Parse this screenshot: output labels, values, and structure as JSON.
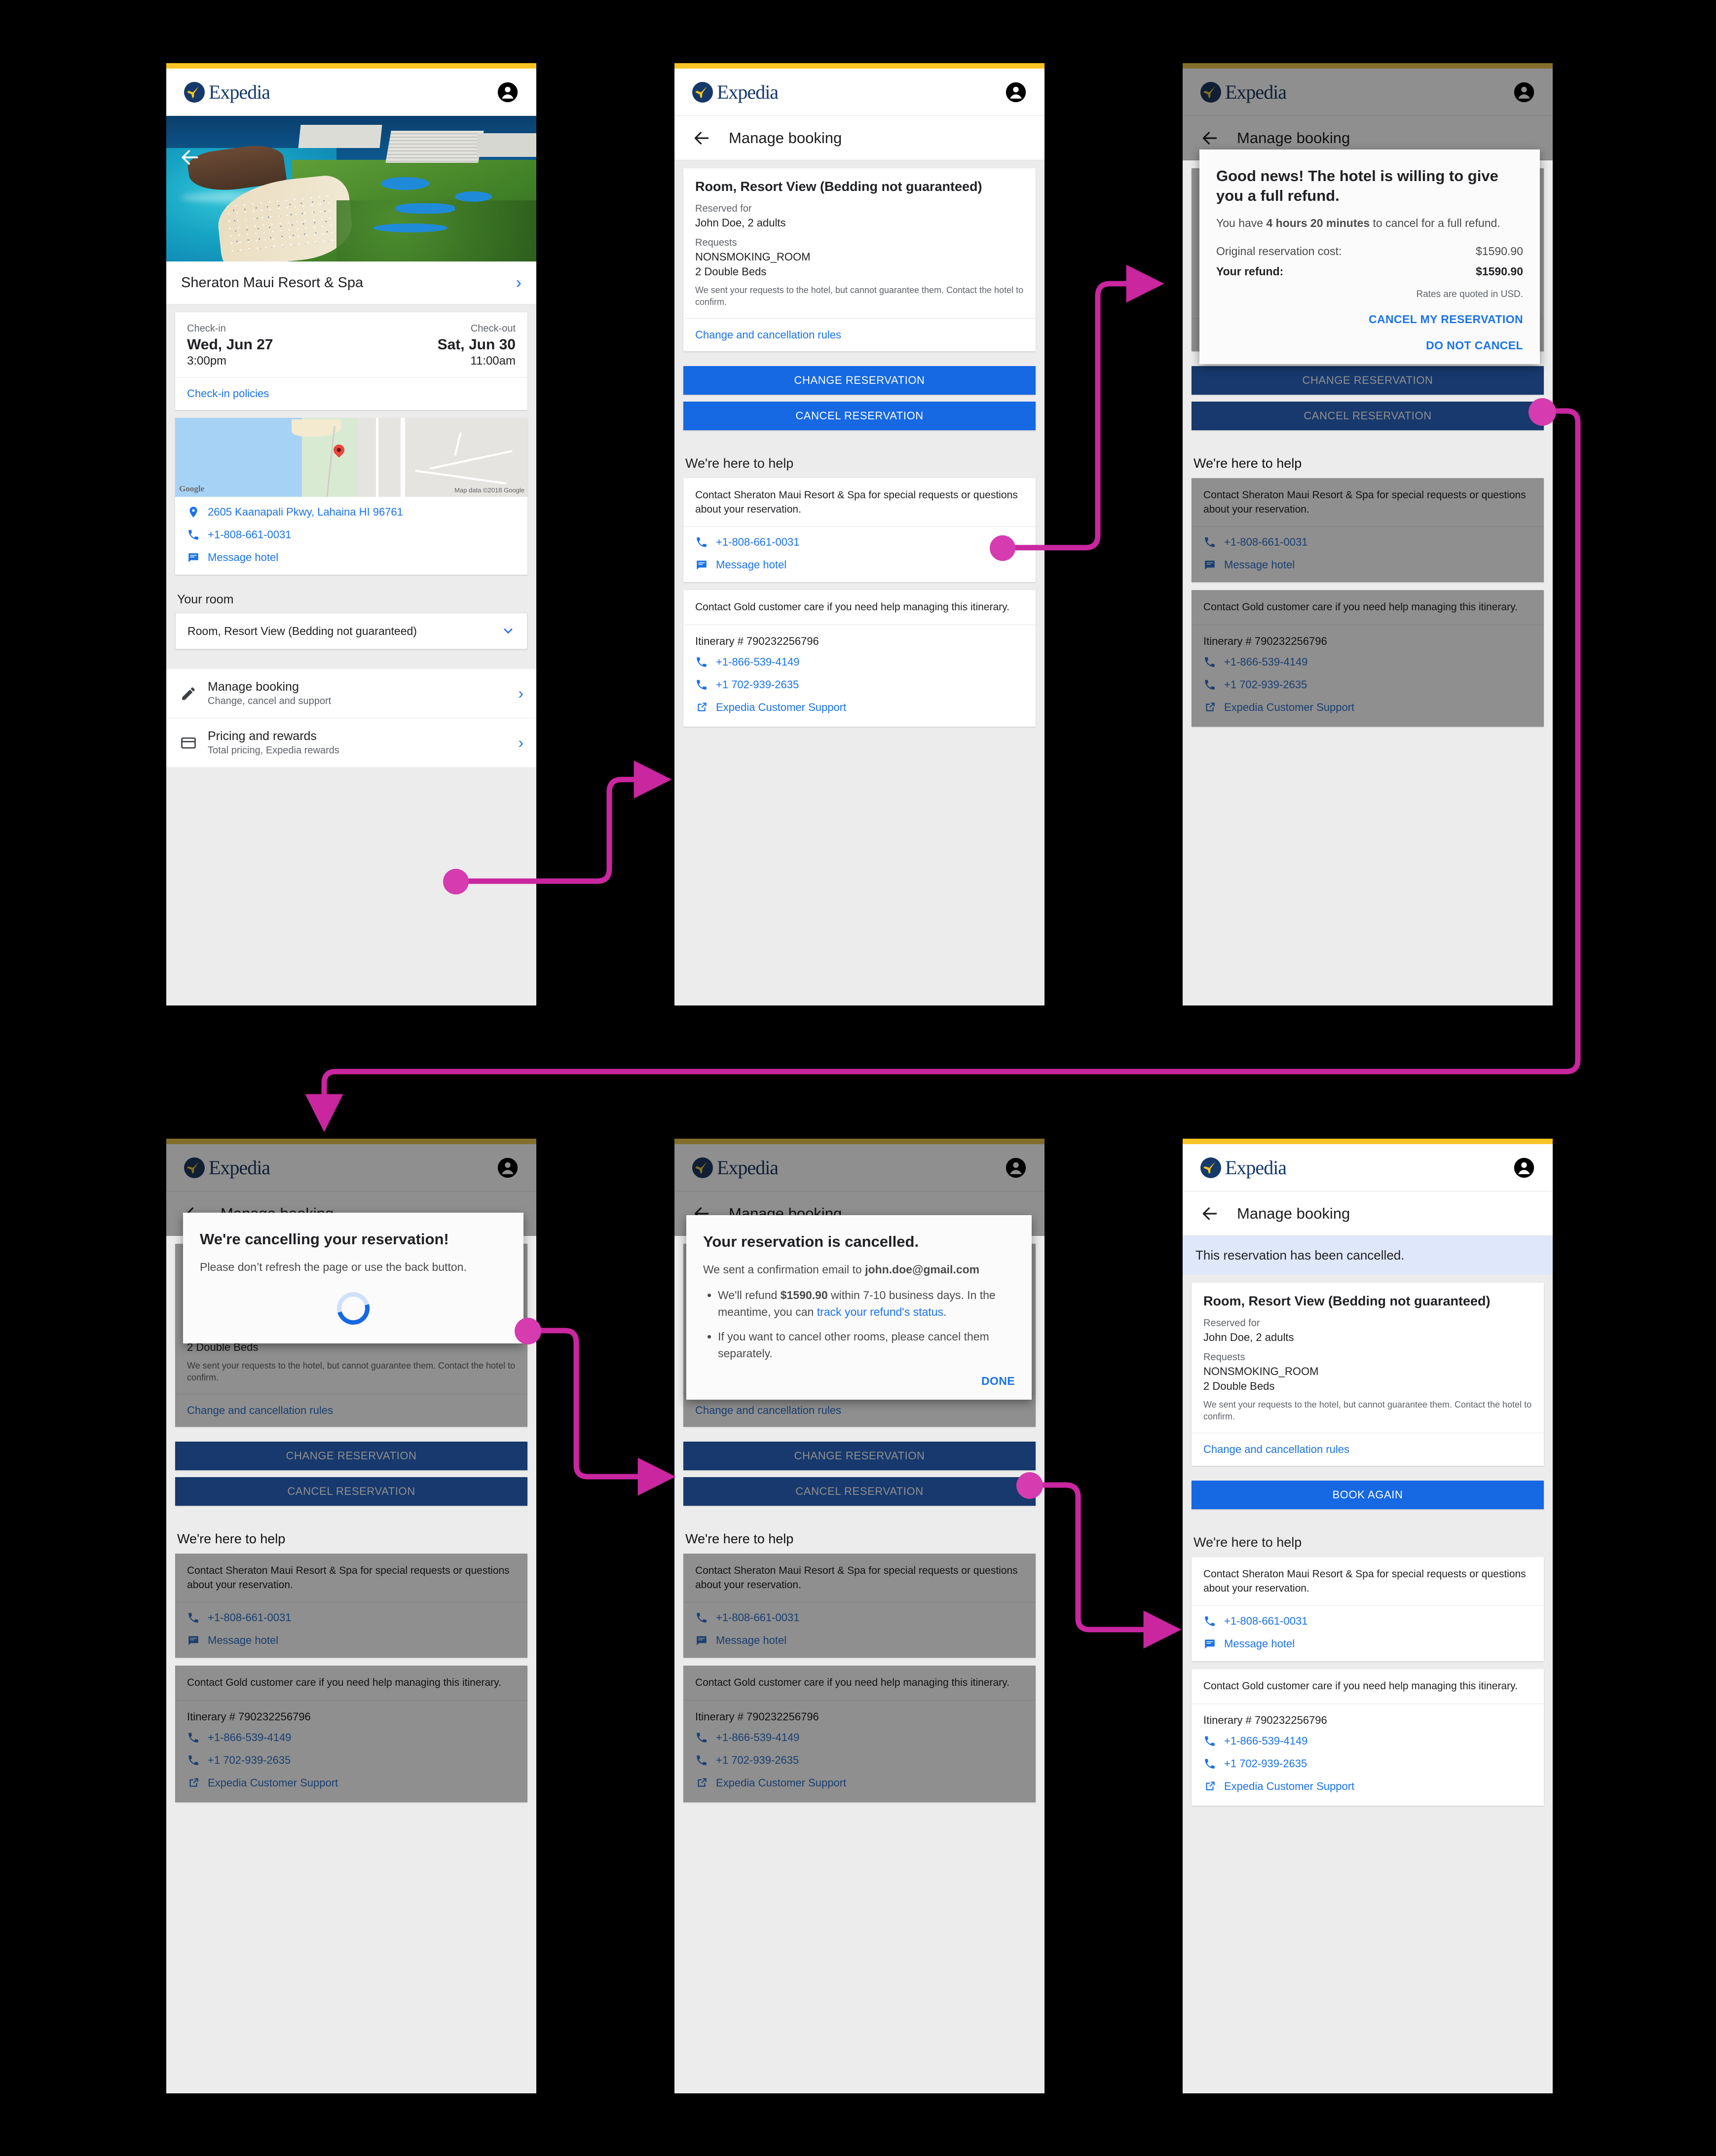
{
  "brand": {
    "name": "Expedia",
    "trademark": "®",
    "accent": "#f9c424",
    "primary": "#1668e3",
    "link": "#1a73e8",
    "connector": "#c9269f"
  },
  "screen1": {
    "nav": {
      "back": "back-arrow"
    },
    "hotel_name": "Sheraton Maui Resort & Spa",
    "checkin_label": "Check-in",
    "checkout_label": "Check-out",
    "checkin_date": "Wed, Jun 27",
    "checkout_date": "Sat, Jun 30",
    "checkin_time": "3:00pm",
    "checkout_time": "11:00am",
    "policies_link": "Check-in policies",
    "map_watermark": "Google",
    "map_attribution": "Map data ©2018 Google",
    "address": "2605 Kaanapali Pkwy, Lahaina HI 96761",
    "phone": "+1-808-661-0031",
    "message_hotel": "Message hotel",
    "your_room_label": "Your room",
    "room_select": "Room, Resort View (Bedding not guaranteed)",
    "menu": [
      {
        "title": "Manage booking",
        "subtitle": "Change, cancel and support"
      },
      {
        "title": "Pricing and rewards",
        "subtitle": "Total pricing, Expedia rewards"
      }
    ]
  },
  "manage": {
    "title": "Manage booking",
    "room_title": "Room, Resort View (Bedding not guaranteed)",
    "reserved_for_label": "Reserved for",
    "reserved_for": "John Doe, 2 adults",
    "requests_label": "Requests",
    "request_1": "NONSMOKING_ROOM",
    "request_2": "2 Double Beds",
    "requests_note": "We sent your requests to the hotel, but cannot guarantee them. Contact the hotel to confirm.",
    "rules_link": "Change and cancellation rules",
    "change_btn": "CHANGE RESERVATION",
    "cancel_btn": "CANCEL RESERVATION",
    "book_again_btn": "BOOK AGAIN",
    "cancelled_banner": "This reservation has been cancelled.",
    "help_heading": "We're here to help",
    "hotel_help_text": "Contact Sheraton Maui Resort & Spa for special requests or questions about your reservation.",
    "hotel_phone": "+1-808-661-0031",
    "message_hotel": "Message hotel",
    "gold_help_text": "Contact Gold customer care if you need help managing this itinerary.",
    "itinerary": "Itinerary # 790232256796",
    "support_phone_1": "+1-866-539-4149",
    "support_phone_2": "+1 702-939-2635",
    "support_link": "Expedia Customer Support"
  },
  "refund_dialog": {
    "heading": "Good news! The hotel is willing to give you a full refund.",
    "body_pre": "You have ",
    "body_strong": "4 hours 20 minutes",
    "body_post": " to cancel for a full refund.",
    "original_label": "Original reservation cost:",
    "original_value": "$1590.90",
    "refund_label": "Your refund:",
    "refund_value": "$1590.90",
    "rates_note": "Rates are quoted in USD.",
    "confirm_action": "CANCEL MY RESERVATION",
    "dismiss_action": "DO NOT CANCEL"
  },
  "progress_dialog": {
    "heading": "We're cancelling your reservation!",
    "body": "Please don’t refresh the page or use the back button."
  },
  "success_dialog": {
    "heading": "Your reservation is cancelled.",
    "body_pre": "We sent a confirmation email to ",
    "email": "john.doe@gmail.com",
    "bullet1_pre": "We'll refund ",
    "bullet1_amount": "$1590.90",
    "bullet1_mid": " within 7-10 business days. In the meantime, you can ",
    "bullet1_link": "track your refund's status",
    "bullet1_post": ".",
    "bullet2": "If you want to cancel other rooms, please cancel them separately.",
    "done_action": "DONE"
  }
}
